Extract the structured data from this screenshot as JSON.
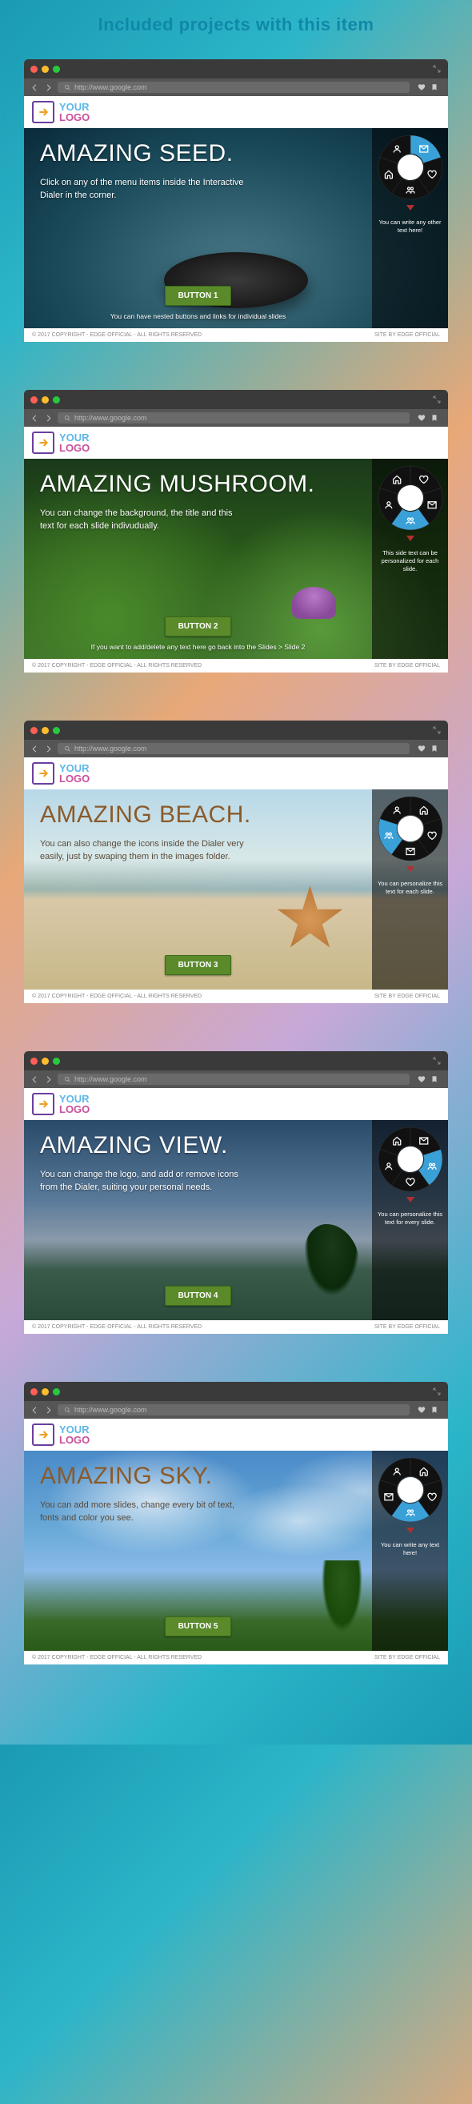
{
  "page_title": "Included projects with this item",
  "logo": {
    "line1": "YOUR",
    "line2": "LOGO"
  },
  "url_placeholder": "http://www.google.com",
  "footer": {
    "left": "© 2017 COPYRIGHT - EDGE OFFICIAL - ALL RIGHTS RESERVED",
    "right": "SITE BY EDGE OFFICIAL"
  },
  "slides": [
    {
      "title": "AMAZING SEED.",
      "desc": "Click on any of the menu items inside the Interactive Dialer in the corner.",
      "button": "BUTTON 1",
      "caption": "You can have nested buttons and links for individual slides",
      "side": "You can write any other text here!",
      "theme": "light",
      "bg": "bg-seed",
      "dialer": {
        "active": 0,
        "icons": [
          "mail",
          "heart",
          "users",
          "home",
          "user"
        ]
      }
    },
    {
      "title": "AMAZING MUSHROOM.",
      "desc": "You can change the background, the title and this text for each slide indivudually.",
      "button": "BUTTON 2",
      "caption": "If you want to add/delete any text here go back into the Slides > Slide 2",
      "side": "This side text can be personalized for each slide.",
      "theme": "light",
      "bg": "bg-mushroom",
      "dialer": {
        "active": 2,
        "icons": [
          "heart",
          "mail",
          "users",
          "user",
          "home"
        ]
      }
    },
    {
      "title": "AMAZING BEACH.",
      "desc": "You can also change the icons inside the Dialer very easily, just by swaping them in the images folder.",
      "button": "BUTTON 3",
      "caption": "",
      "side": "You can personalize this text for each slide.",
      "theme": "dark",
      "bg": "bg-beach",
      "dialer": {
        "active": 3,
        "icons": [
          "home",
          "heart",
          "mail",
          "users",
          "user"
        ]
      }
    },
    {
      "title": "AMAZING VIEW.",
      "desc": "You can change the logo, and add or remove icons from the Dialer, suiting your personal needs.",
      "button": "BUTTON 4",
      "caption": "",
      "side": "You can personalize this text for every slide.",
      "theme": "light",
      "bg": "bg-view",
      "dialer": {
        "active": 1,
        "icons": [
          "mail",
          "users",
          "heart",
          "user",
          "home"
        ]
      }
    },
    {
      "title": "AMAZING SKY.",
      "desc": "You can add more slides, change every bit of text, fonts and color you see.",
      "button": "BUTTON 5",
      "caption": "",
      "side": "You can write any text here!",
      "theme": "dark",
      "bg": "bg-sky",
      "dialer": {
        "active": 2,
        "icons": [
          "home",
          "heart",
          "users",
          "mail",
          "user"
        ]
      }
    }
  ]
}
